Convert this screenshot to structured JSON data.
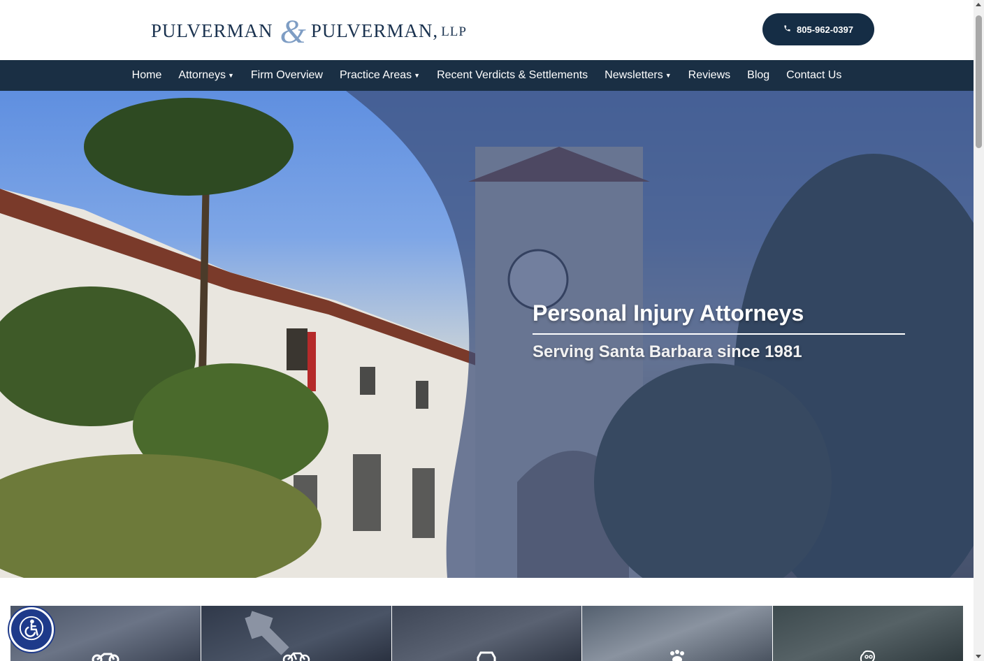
{
  "header": {
    "logo": {
      "word1": "PULVERMAN",
      "amp": "&",
      "word2": "PULVERMAN,",
      "suffix": "LLP"
    },
    "phone_icon": "phone-icon",
    "phone": "805-962-0397"
  },
  "nav": {
    "items": [
      {
        "label": "Home",
        "dropdown": false
      },
      {
        "label": "Attorneys",
        "dropdown": true
      },
      {
        "label": "Firm Overview",
        "dropdown": false
      },
      {
        "label": "Practice Areas",
        "dropdown": true
      },
      {
        "label": "Recent Verdicts & Settlements",
        "dropdown": false
      },
      {
        "label": "Newsletters",
        "dropdown": true
      },
      {
        "label": "Reviews",
        "dropdown": false
      },
      {
        "label": "Blog",
        "dropdown": false
      },
      {
        "label": "Contact Us",
        "dropdown": false
      }
    ]
  },
  "hero": {
    "title": "Personal Injury Attorneys",
    "subtitle": "Serving Santa Barbara since 1981"
  },
  "practice_cards": [
    {
      "icon": "motorcycle-icon"
    },
    {
      "icon": "bicycle-icon"
    },
    {
      "icon": "car-icon"
    },
    {
      "icon": "paw-icon"
    },
    {
      "icon": "brain-icon"
    }
  ],
  "accessibility": {
    "icon": "accessibility-icon"
  },
  "colors": {
    "navy": "#1a2f44",
    "button": "#152d45",
    "logo_text": "#1b3350",
    "logo_amp": "#7e9dc4",
    "hero_overlay": "#3b4e78",
    "a11y": "#1e3a8a"
  }
}
